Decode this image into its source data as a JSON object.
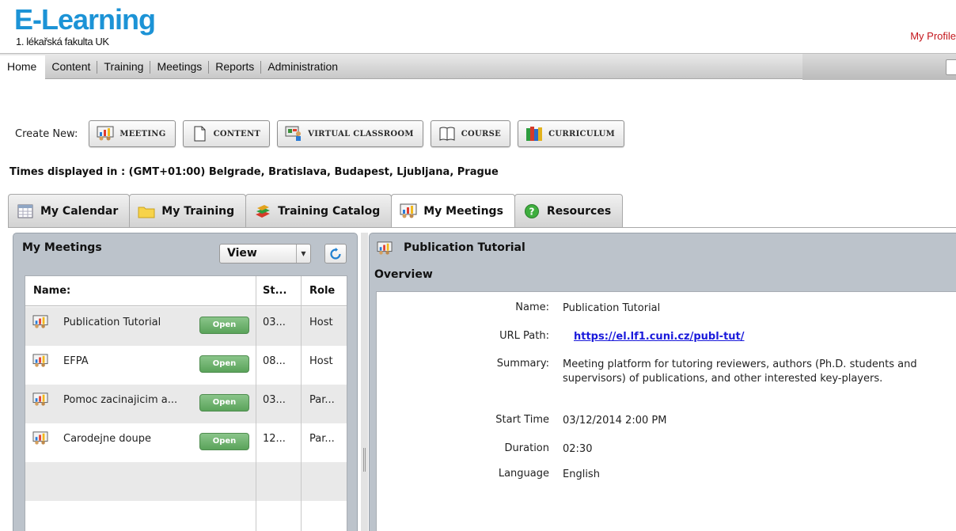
{
  "app": {
    "logo_title": "E-Learning",
    "logo_subtitle": "1. lékařská fakulta UK",
    "my_profile": "My Profile",
    "colors": {
      "logo": "#1c93d6",
      "profile_link": "#c4161c",
      "open_button": "#5aa35a",
      "link": "#1a1adb"
    }
  },
  "nav": {
    "items": [
      "Home",
      "Content",
      "Training",
      "Meetings",
      "Reports",
      "Administration"
    ],
    "active": "Home"
  },
  "create_new": {
    "label": "Create New:",
    "buttons": [
      {
        "label": "MEETING",
        "icon": "meeting-icon"
      },
      {
        "label": "CONTENT",
        "icon": "document-icon"
      },
      {
        "label": "VIRTUAL CLASSROOM",
        "icon": "virtual-classroom-icon"
      },
      {
        "label": "COURSE",
        "icon": "book-icon"
      },
      {
        "label": "CURRICULUM",
        "icon": "books-icon"
      }
    ]
  },
  "timezone": "Times displayed in : (GMT+01:00) Belgrade, Bratislava, Budapest, Ljubljana, Prague",
  "tabs": [
    {
      "label": "My Calendar",
      "icon": "calendar-icon"
    },
    {
      "label": "My Training",
      "icon": "folder-icon"
    },
    {
      "label": "Training Catalog",
      "icon": "books-stack-icon"
    },
    {
      "label": "My Meetings",
      "icon": "meeting-icon",
      "active": true
    },
    {
      "label": "Resources",
      "icon": "help-icon"
    }
  ],
  "meetings_panel": {
    "title": "My Meetings",
    "view_select": "View",
    "columns": [
      "Name:",
      "St...",
      "Role"
    ],
    "rows": [
      {
        "name": "Publication Tutorial",
        "open": "Open",
        "start": "03...",
        "role": "Host",
        "selected": true
      },
      {
        "name": "EFPA",
        "open": "Open",
        "start": "08...",
        "role": "Host"
      },
      {
        "name": "Pomoc zacinajicim a...",
        "open": "Open",
        "start": "03...",
        "role": "Par..."
      },
      {
        "name": "Carodejne doupe",
        "open": "Open",
        "start": "12...",
        "role": "Par..."
      }
    ]
  },
  "detail": {
    "title": "Publication Tutorial",
    "section": "Overview",
    "fields": [
      {
        "label": "Name:",
        "value": "Publication Tutorial"
      },
      {
        "label": "URL Path:",
        "value": "https://el.lf1.cuni.cz/publ-tut/",
        "link": true
      },
      {
        "label": "Summary:",
        "value": "Meeting platform for tutoring reviewers, authors (Ph.D. students and supervisors) of publications, and other interested key-players."
      },
      {
        "label": "Start Time",
        "value": "03/12/2014 2:00 PM"
      },
      {
        "label": "Duration",
        "value": "02:30"
      },
      {
        "label": "Language",
        "value": "English"
      }
    ]
  }
}
